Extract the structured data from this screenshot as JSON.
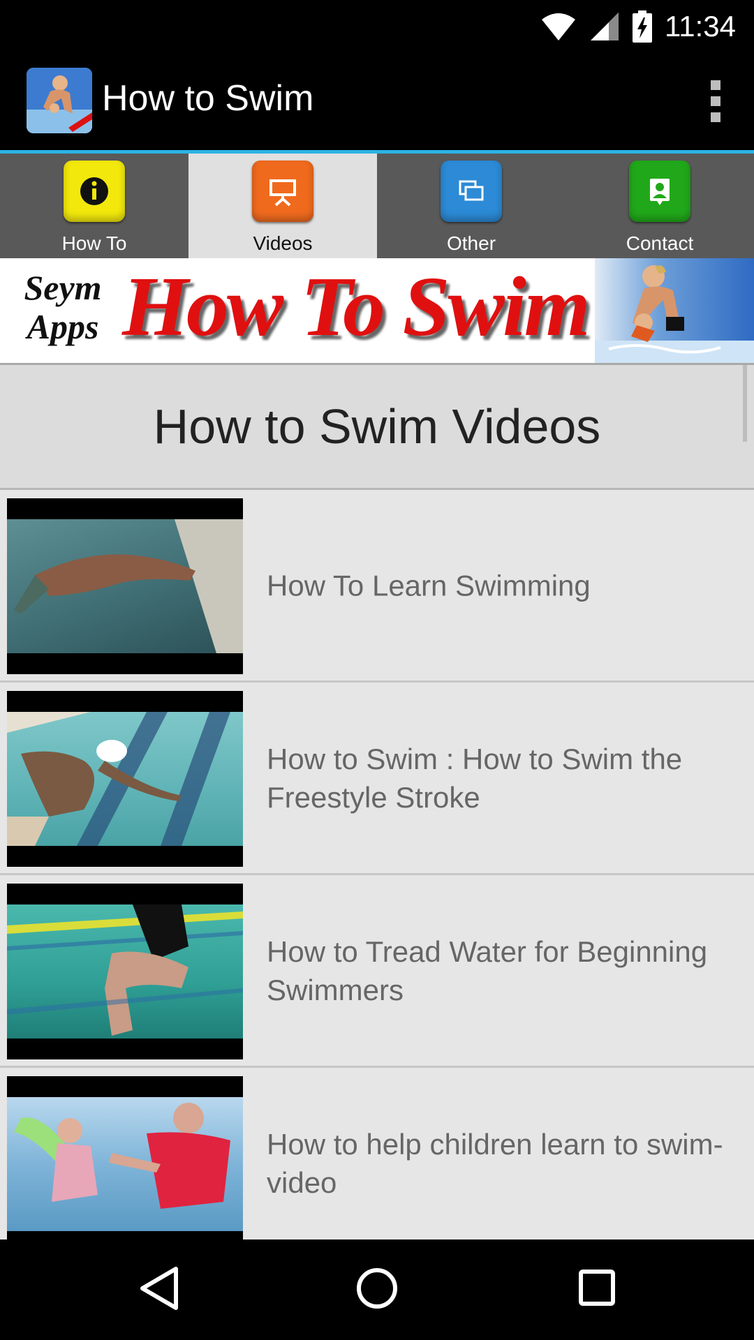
{
  "status_bar": {
    "time": "11:34",
    "icons": [
      "wifi-icon",
      "cell-signal-icon",
      "battery-charging-icon"
    ]
  },
  "app_bar": {
    "title": "How to Swim",
    "icon": "swimmer-app-icon",
    "menu_icon": "overflow-menu-icon"
  },
  "tabs": [
    {
      "label": "How To",
      "icon": "info-icon",
      "color": "#f2e80c"
    },
    {
      "label": "Videos",
      "icon": "presentation-icon",
      "color": "#f06a1e",
      "active": true
    },
    {
      "label": "Other",
      "icon": "copy-icon",
      "color": "#2c8ad6"
    },
    {
      "label": "Contact",
      "icon": "contact-icon",
      "color": "#21a81a"
    }
  ],
  "banner": {
    "brand_line1": "Seym",
    "brand_line2": "Apps",
    "title": "How To Swim"
  },
  "header": {
    "title": "How to Swim Videos"
  },
  "videos": [
    {
      "title": "How To Learn Swimming"
    },
    {
      "title": "How to Swim : How to Swim the Freestyle Stroke"
    },
    {
      "title": "How to Tread Water for Beginning Swimmers"
    },
    {
      "title": "How to help children learn to swim- video"
    }
  ],
  "nav": {
    "back": "back-icon",
    "home": "home-icon",
    "recents": "recents-icon"
  },
  "colors": {
    "accent": "#2bb3e5",
    "banner_red": "#e01010"
  }
}
